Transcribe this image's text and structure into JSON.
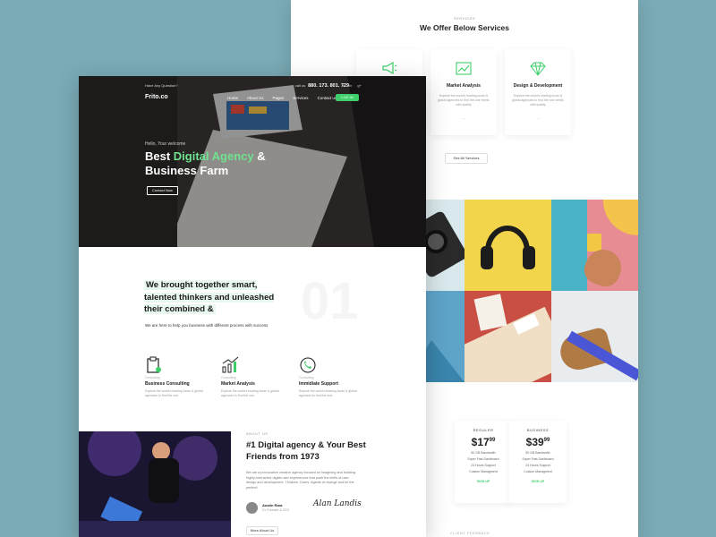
{
  "colors": {
    "background": "#7aabb6",
    "accent": "#3ecf6a",
    "accent_light": "#6fe38f"
  },
  "services": {
    "kicker": "SERVICES",
    "title": "We Offer Below Services",
    "cards": [
      {
        "name": "",
        "desc": "",
        "more": "",
        "icon": "megaphone-icon"
      },
      {
        "name": "Market Analysis",
        "desc": "Explore the world's leading locan & global agencies to find the one needs with quality",
        "more": "—",
        "icon": "chart-icon"
      },
      {
        "name": "Design & Development",
        "desc": "Explore the world's leading locan & global agencies to find the one needs with quality",
        "more": "—",
        "icon": "diamond-icon"
      }
    ],
    "see_all": "See All Services"
  },
  "pricing": {
    "plans": [
      {
        "name": "REGULER",
        "price": "$17",
        "cents": "99",
        "features": [
          "50 GB Bandwidth",
          "Super Fast Dashboard",
          "24 Hours Support",
          "Custom Managment"
        ],
        "cta": "SIGN UP"
      },
      {
        "name": "BUSINESS",
        "price": "$39",
        "cents": "99",
        "features": [
          "50 GB Bandwidth",
          "Super Fast Dashboard",
          "24 Hours Support",
          "Custom Managment"
        ],
        "cta": "SIGN UP"
      }
    ]
  },
  "client_feedback": "CLIENT FEEDBACK",
  "header": {
    "have_question": "Have Any Question?",
    "call_label": "call us",
    "phone": "880. 173. 801. 729",
    "social": [
      "f",
      "t",
      "in",
      "g+"
    ],
    "logo": "Frito.co",
    "nav": [
      "Home",
      "About Us",
      "Pages",
      "Services",
      "Contact us"
    ],
    "login": "LOG IN"
  },
  "hero": {
    "hello": "Hello, Your welcome",
    "title_a": "Best ",
    "title_accent": "Digital Agency",
    "title_b": " & Business Farm",
    "cta": "Contact Now"
  },
  "intro": {
    "title": "We brought together smart, talented thinkers and unleashed their combined &",
    "number": "01",
    "sub": "We are here to help you business with different process with success"
  },
  "features": [
    {
      "kicker": "Consulting",
      "name": "Business Consulting",
      "desc": "Explore the world's leading locan & global agencies to find the one.",
      "icon": "clipboard-icon"
    },
    {
      "kicker": "Consulting",
      "name": "Market Analysis",
      "desc": "Explore the world's leading locan & global agencies to find the one.",
      "icon": "growth-chart-icon"
    },
    {
      "kicker": "Consulting",
      "name": "Immidiate Support",
      "desc": "Explore the world's leading locan & global agencies to find the one.",
      "icon": "support-phone-icon"
    }
  ],
  "about": {
    "kicker": "ABOUT US",
    "title": "#1 Digital agency & Your Best Friends from 1973",
    "desc": "We are a provocative creative agency focused on imagining and building highly-interactive digital user experiences that push the limits of user design and development. Thinkers. Doers. Agents of change and be the perfect!",
    "author": "Austin Rara",
    "role": "Co Founder & CEO",
    "signature": "Alan Landis",
    "more": "More About Us"
  }
}
